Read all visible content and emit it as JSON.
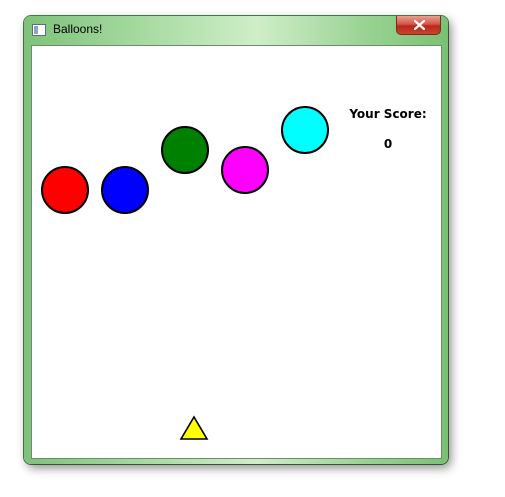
{
  "window": {
    "title": "Balloons!"
  },
  "score": {
    "label": "Your Score:",
    "value": "0"
  },
  "balloons": [
    {
      "color": "#ff0000"
    },
    {
      "color": "#0000ff"
    },
    {
      "color": "#008000"
    },
    {
      "color": "#ff00ff"
    },
    {
      "color": "#00ffff"
    }
  ],
  "shooter": {
    "color": "#ffff00",
    "icon": "triangle-icon"
  },
  "close_icon": "close-icon"
}
